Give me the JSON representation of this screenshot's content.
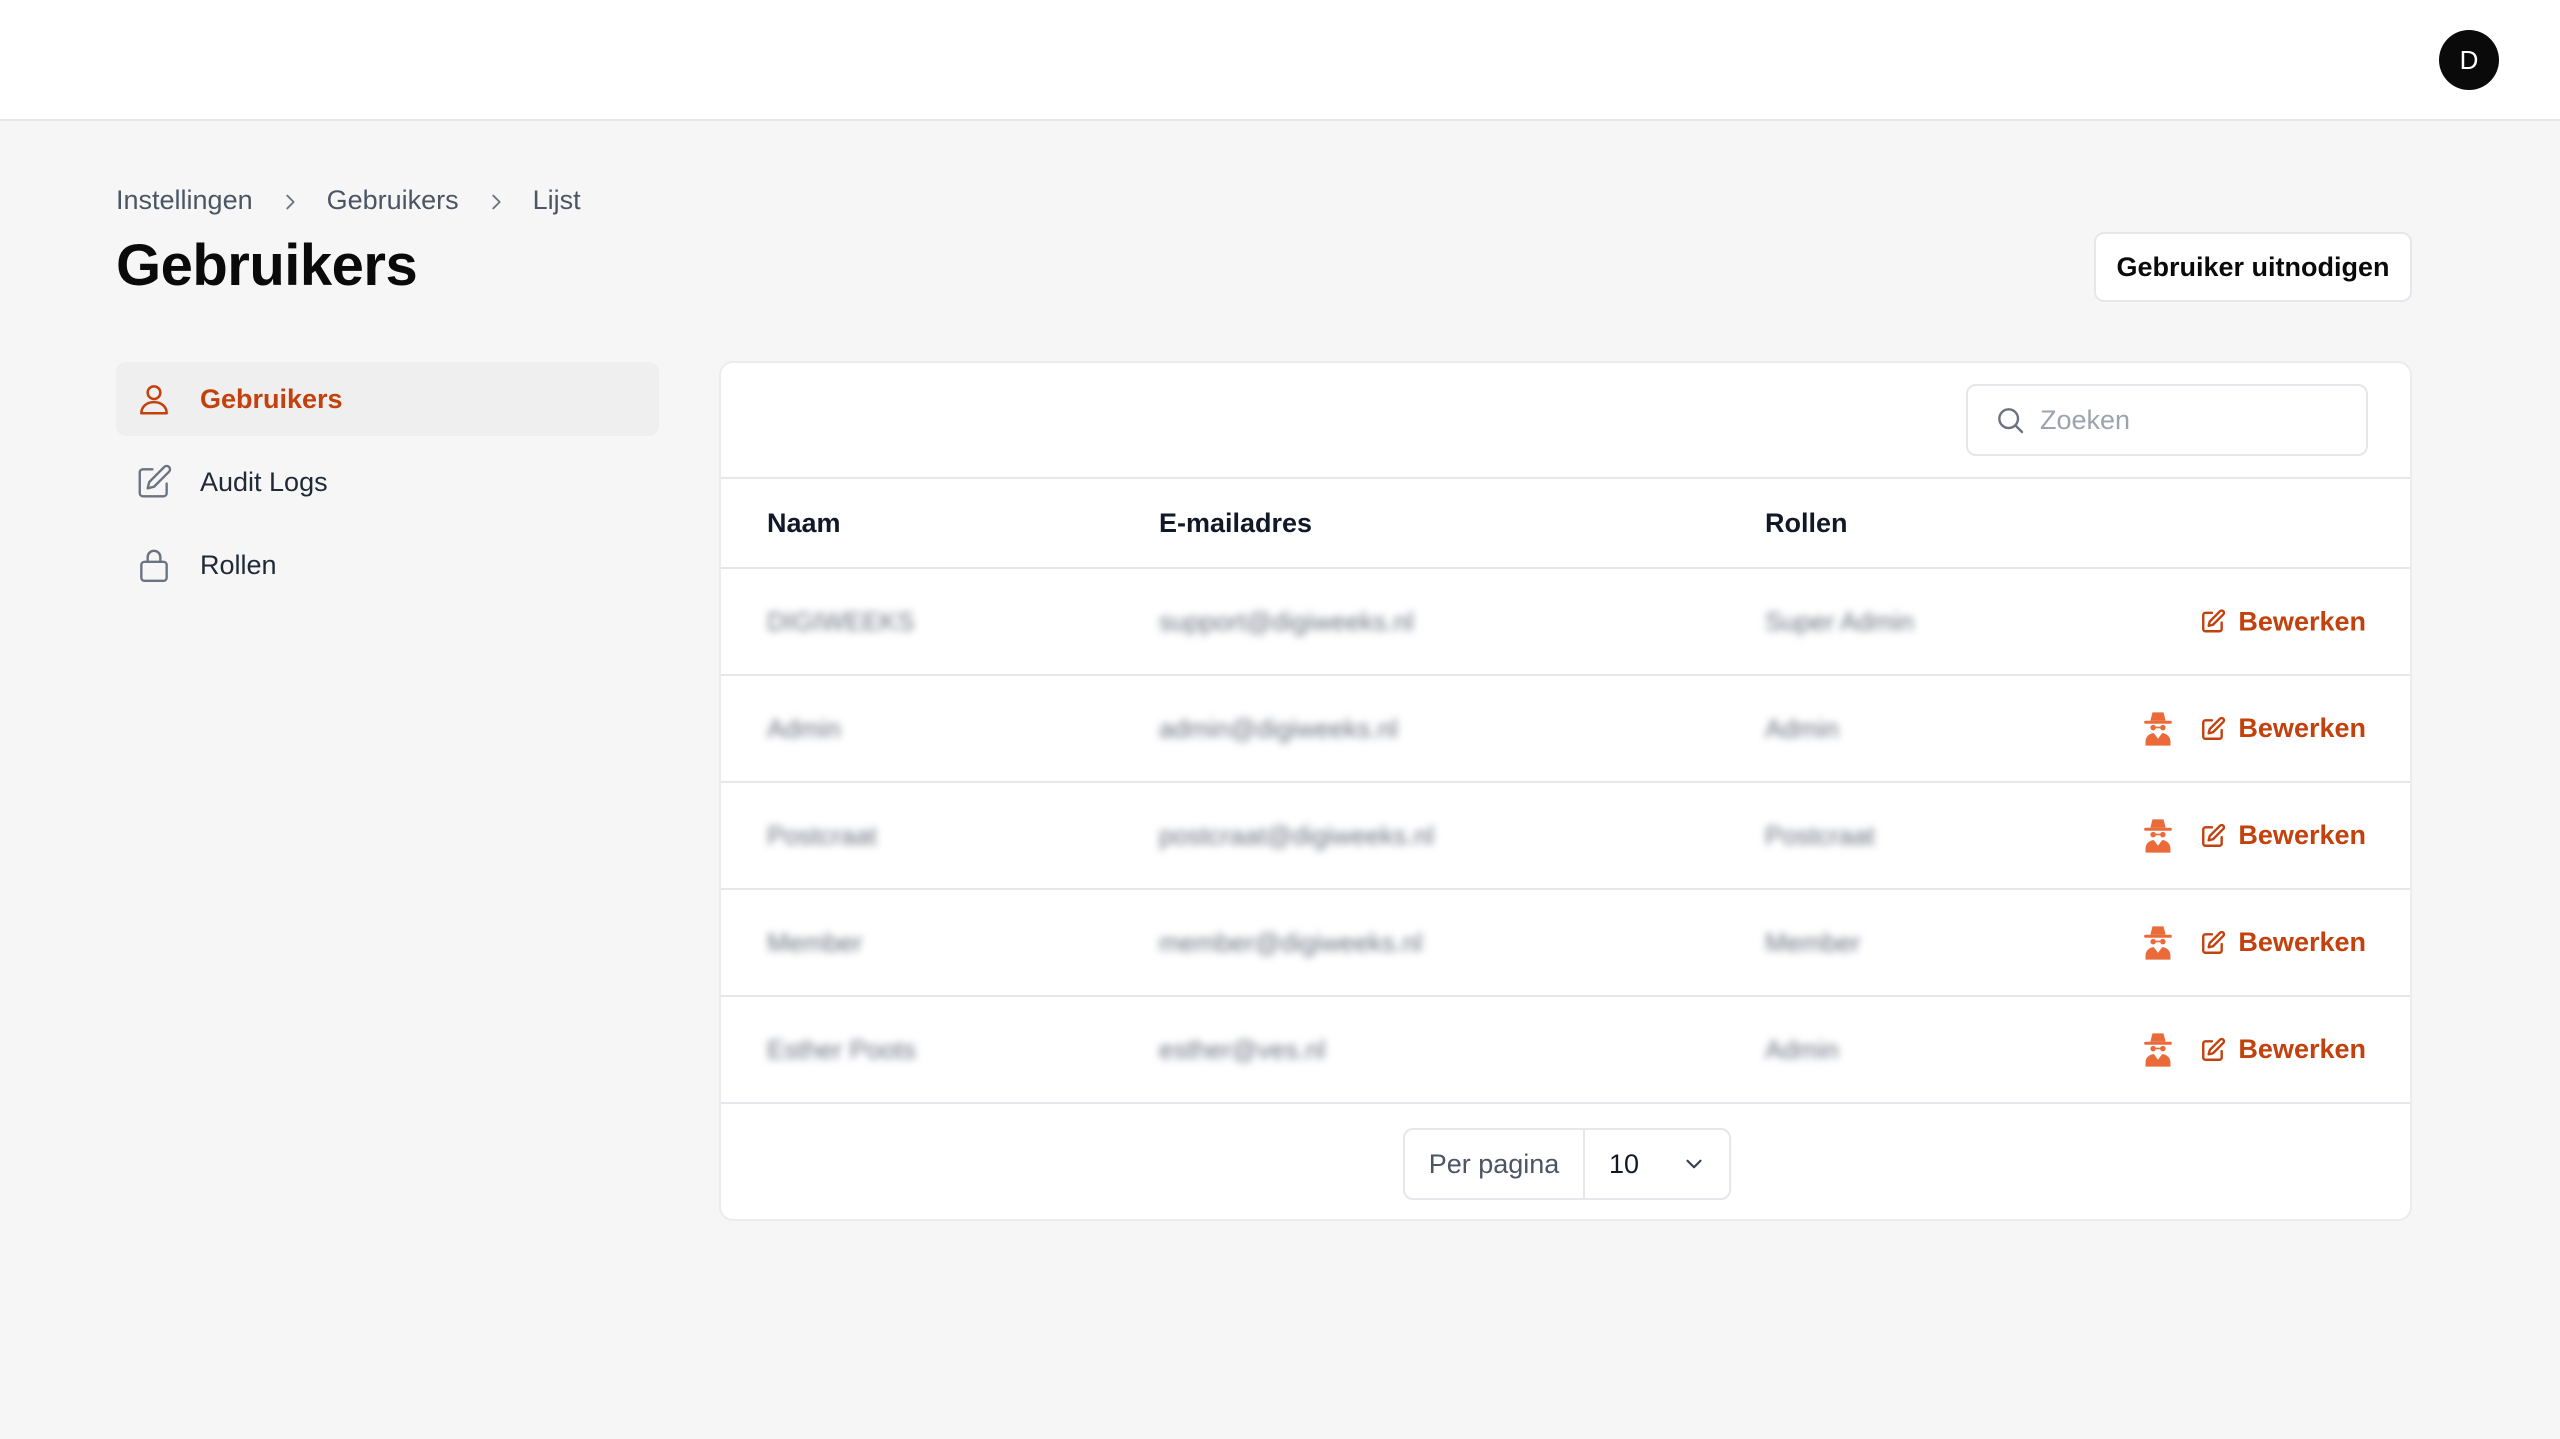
{
  "header": {
    "avatar_initial": "D"
  },
  "breadcrumb": [
    "Instellingen",
    "Gebruikers",
    "Lijst"
  ],
  "page": {
    "title": "Gebruikers",
    "invite_label": "Gebruiker uitnodigen"
  },
  "sidebar": {
    "items": [
      {
        "label": "Gebruikers",
        "icon": "user-icon",
        "active": true
      },
      {
        "label": "Audit Logs",
        "icon": "edit-icon",
        "active": false
      },
      {
        "label": "Rollen",
        "icon": "lock-icon",
        "active": false
      }
    ]
  },
  "search": {
    "placeholder": "Zoeken",
    "value": ""
  },
  "table": {
    "columns": [
      "Naam",
      "E-mailadres",
      "Rollen"
    ],
    "edit_label": "Bewerken",
    "rows": [
      {
        "name": "DIGIWEEKS",
        "email": "support@digiweeks.nl",
        "role": "Super Admin",
        "impersonate": false
      },
      {
        "name": "Admin",
        "email": "admin@digiweeks.nl",
        "role": "Admin",
        "impersonate": true
      },
      {
        "name": "Postcraat",
        "email": "postcraat@digiweeks.nl",
        "role": "Postcraat",
        "impersonate": true
      },
      {
        "name": "Member",
        "email": "member@digiweeks.nl",
        "role": "Member",
        "impersonate": true
      },
      {
        "name": "Esther Poots",
        "email": "esther@ves.nl",
        "role": "Admin",
        "impersonate": true
      }
    ]
  },
  "pagination": {
    "per_page_label": "Per pagina",
    "per_page_value": "10"
  },
  "colors": {
    "accent": "#c2410c",
    "background": "#f6f6f6"
  }
}
